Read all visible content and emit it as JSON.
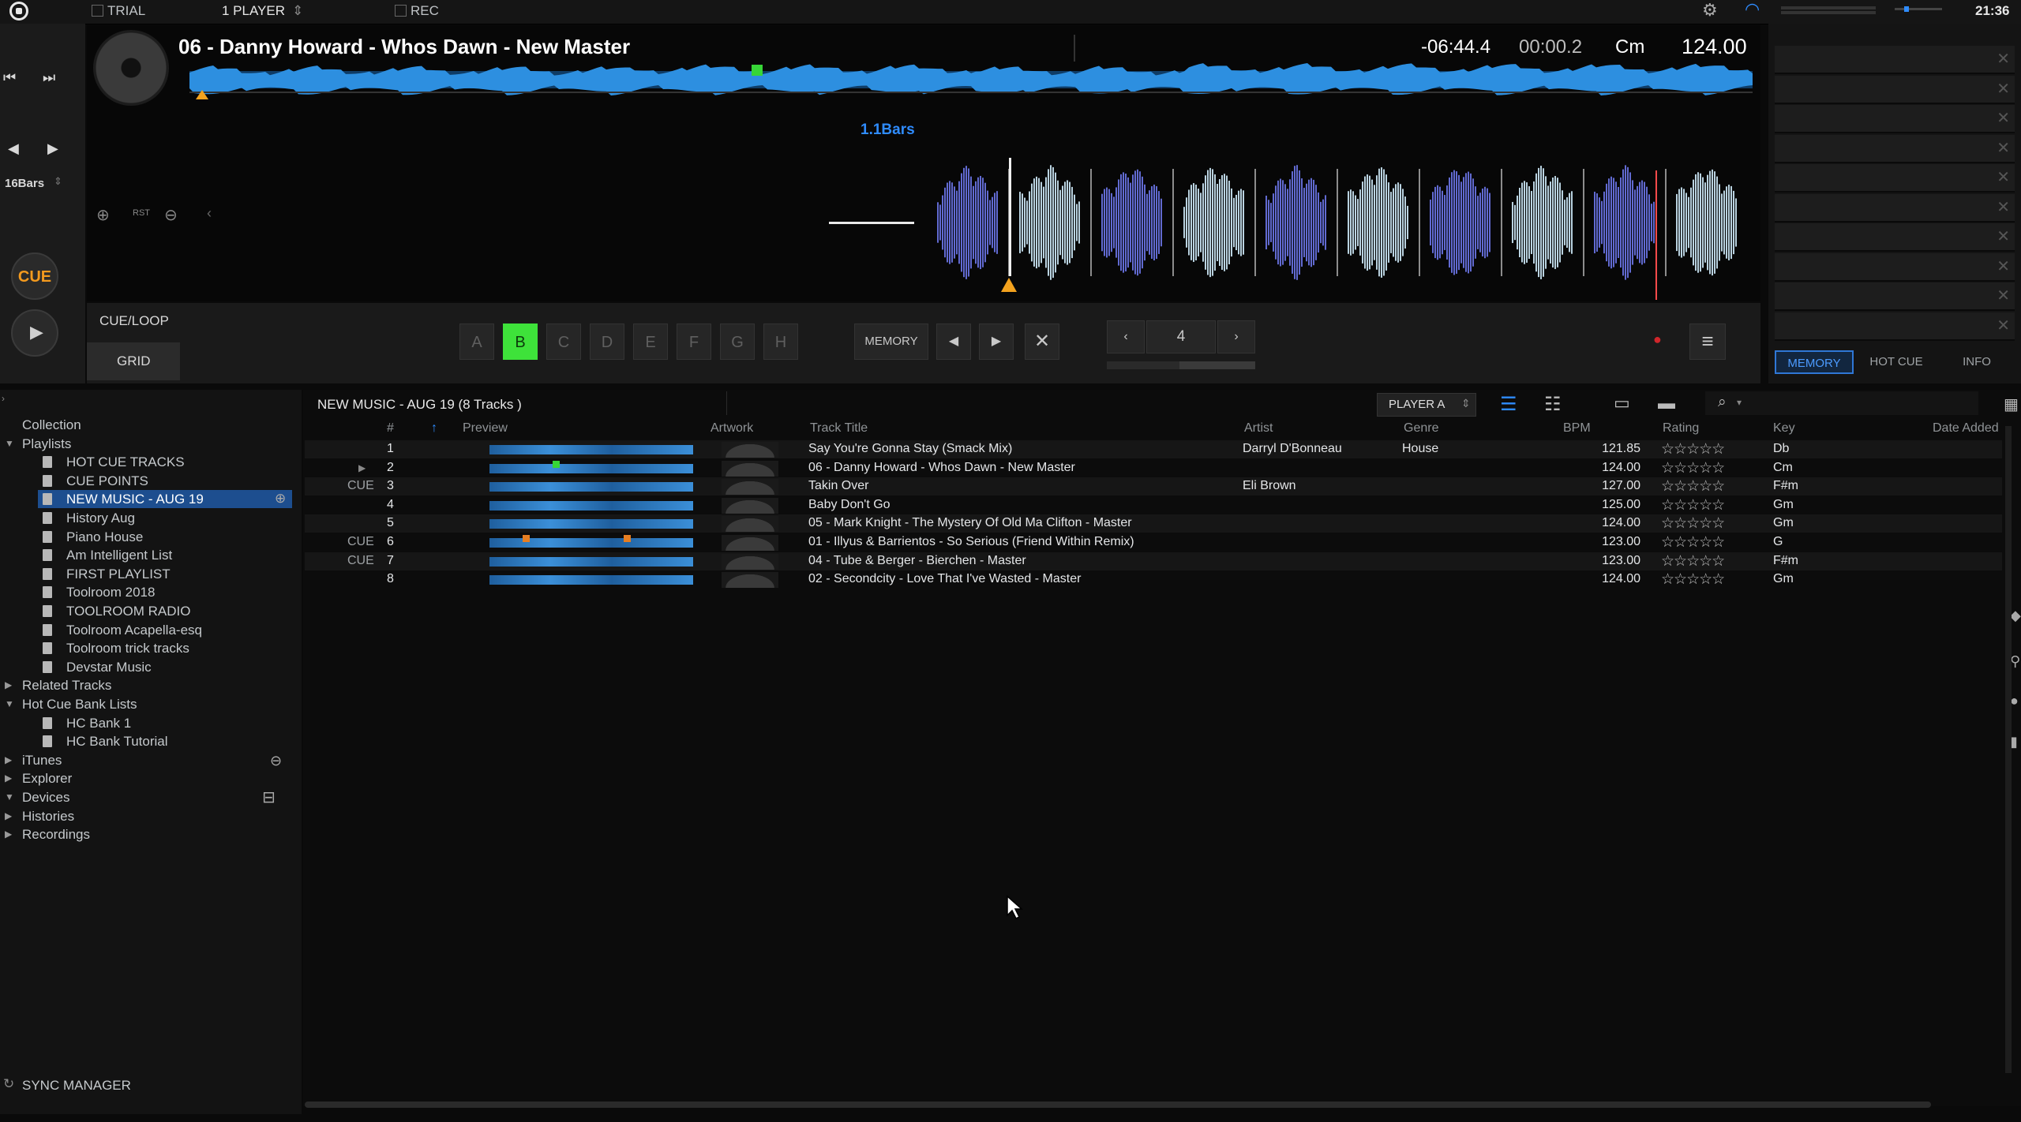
{
  "topbar": {
    "trial": "TRIAL",
    "player_mode": "1 PLAYER",
    "rec": "REC",
    "clock": "21:36"
  },
  "deck": {
    "track_title": "06 - Danny Howard - Whos Dawn - New Master",
    "remaining": "-06:44.4",
    "elapsed": "00:00.2",
    "key": "Cm",
    "bpm": "124.00",
    "bars_readout": "1.1Bars",
    "beat_jump": "16Bars",
    "rst": "RST",
    "cue_label": "CUE",
    "tab_cue_loop": "CUE/LOOP",
    "tab_grid": "GRID",
    "hot_cues": [
      "A",
      "B",
      "C",
      "D",
      "E",
      "F",
      "G",
      "H"
    ],
    "active_hot_cue": "B",
    "memory_label": "MEMORY",
    "loop_value": "4"
  },
  "right_panel": {
    "tabs": [
      "MEMORY",
      "HOT CUE",
      "INFO"
    ],
    "active_tab": "MEMORY"
  },
  "tree": {
    "items": [
      {
        "label": "Collection",
        "level": 0,
        "arrow": ""
      },
      {
        "label": "Playlists",
        "level": 0,
        "arrow": "▼"
      },
      {
        "label": "HOT CUE TRACKS",
        "level": 1
      },
      {
        "label": "CUE POINTS",
        "level": 1
      },
      {
        "label": "NEW MUSIC - AUG 19",
        "level": 1,
        "selected": true
      },
      {
        "label": "History Aug",
        "level": 1
      },
      {
        "label": "Piano House",
        "level": 1
      },
      {
        "label": "Am Intelligent List",
        "level": 1
      },
      {
        "label": "FIRST PLAYLIST",
        "level": 1
      },
      {
        "label": "Toolroom 2018",
        "level": 1
      },
      {
        "label": "TOOLROOM RADIO",
        "level": 1
      },
      {
        "label": "Toolroom Acapella-esq",
        "level": 1
      },
      {
        "label": "Toolroom trick tracks",
        "level": 1
      },
      {
        "label": "Devstar Music",
        "level": 1
      },
      {
        "label": "Related Tracks",
        "level": 0,
        "arrow": "▶"
      },
      {
        "label": "Hot Cue Bank Lists",
        "level": 0,
        "arrow": "▼"
      },
      {
        "label": "HC Bank 1",
        "level": 1
      },
      {
        "label": "HC Bank Tutorial",
        "level": 1
      },
      {
        "label": "iTunes",
        "level": 0,
        "arrow": "▶"
      },
      {
        "label": "Explorer",
        "level": 0,
        "arrow": "▶"
      },
      {
        "label": "Devices",
        "level": 0,
        "arrow": "▼"
      },
      {
        "label": "Histories",
        "level": 0,
        "arrow": "▶"
      },
      {
        "label": "Recordings",
        "level": 0,
        "arrow": "▶"
      }
    ],
    "sync_manager": "SYNC MANAGER"
  },
  "list": {
    "heading": "NEW MUSIC - AUG 19 (8 Tracks )",
    "player_select": "PLAYER A",
    "columns": {
      "num": "#",
      "preview": "Preview",
      "artwork": "Artwork",
      "title": "Track Title",
      "artist": "Artist",
      "genre": "Genre",
      "bpm": "BPM",
      "rating": "Rating",
      "key": "Key",
      "date": "Date Added"
    },
    "tracks": [
      {
        "cue": "",
        "num": "1",
        "title": "Say You're Gonna Stay (Smack Mix)",
        "artist": "Darryl D'Bonneau",
        "genre": "House",
        "bpm": "121.85",
        "key": "Db"
      },
      {
        "cue": "",
        "num": "2",
        "title": "06 - Danny Howard - Whos Dawn - New Master",
        "artist": "",
        "genre": "",
        "bpm": "124.00",
        "key": "Cm"
      },
      {
        "cue": "CUE",
        "num": "3",
        "title": "Takin Over",
        "artist": "Eli Brown",
        "genre": "",
        "bpm": "127.00",
        "key": "F#m"
      },
      {
        "cue": "",
        "num": "4",
        "title": "Baby Don't Go",
        "artist": "",
        "genre": "",
        "bpm": "125.00",
        "key": "Gm"
      },
      {
        "cue": "",
        "num": "5",
        "title": "05 - Mark Knight - The Mystery Of Old Ma Clifton - Master",
        "artist": "",
        "genre": "",
        "bpm": "124.00",
        "key": "Gm"
      },
      {
        "cue": "CUE",
        "num": "6",
        "title": "01 - Illyus & Barrientos - So Serious (Friend Within Remix)",
        "artist": "",
        "genre": "",
        "bpm": "123.00",
        "key": "G"
      },
      {
        "cue": "CUE",
        "num": "7",
        "title": "04 - Tube & Berger - Bierchen - Master",
        "artist": "",
        "genre": "",
        "bpm": "123.00",
        "key": "F#m"
      },
      {
        "cue": "",
        "num": "8",
        "title": "02 - Secondcity - Love That I've Wasted - Master",
        "artist": "",
        "genre": "",
        "bpm": "124.00",
        "key": "Gm"
      }
    ]
  }
}
